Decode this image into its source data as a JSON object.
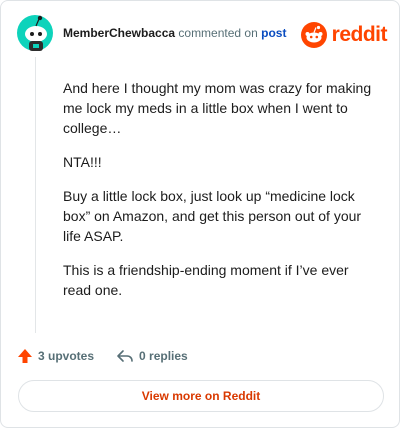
{
  "comment": {
    "username": "MemberChewbacca",
    "action_text": "commented on",
    "post_link": "post",
    "brand": "reddit",
    "paragraphs": [
      "And here I thought my mom was crazy for making me lock my meds in a little box when I went to college…",
      "NTA!!!",
      "Buy a little lock box, just look up “medicine lock box” on Amazon, and get this person out of your life ASAP.",
      "This is a friendship-ending moment if I’ve ever read one."
    ]
  },
  "actions": {
    "upvotes": "3 upvotes",
    "replies": "0 replies"
  },
  "footer": {
    "view_label": "View more on Reddit"
  },
  "colors": {
    "brand": "#ff4500",
    "link": "#0a4cc0",
    "muted": "#576f76",
    "view_button_text": "#d93900",
    "avatar_bg": "#0dd3bb"
  }
}
